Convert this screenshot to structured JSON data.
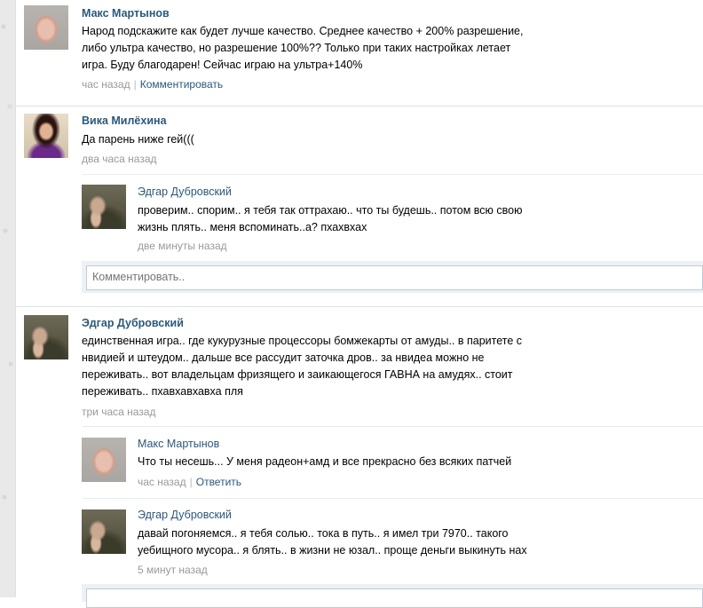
{
  "posts": [
    {
      "author": "Макс Мартынов",
      "lines": [
        "Народ подскажите как будет лучше качество. Среднее качество + 200% разрешение,",
        "либо ультра качество, но разрешение 100%?? Только при таких настройках летает",
        "игра. Буду благодарен! Сейчас играю на ультра+140%"
      ],
      "time": "час назад",
      "action": "Комментировать"
    },
    {
      "author": "Вика Милёхина",
      "lines": [
        "Да парень ниже гей((("
      ],
      "time": "два часа назад",
      "replies": [
        {
          "author": "Эдгар Дубровский",
          "lines": [
            "проверим.. спорим.. я тебя так оттрахаю.. что ты будешь.. потом всю свою",
            "жизнь плять.. меня вспоминать..а? пхахвхах"
          ],
          "time": "две минуты назад"
        }
      ],
      "comment_placeholder": "Комментировать.."
    },
    {
      "author": "Эдгар Дубровский",
      "lines": [
        "единственная игра.. где кукурузные процессоры бомжекарты от амуды.. в паритете с",
        "нвидией и штеудом.. дальше все рассудит заточка дров.. за нвидеа можно не",
        "переживать.. вот владельцам фризящего и заикающегося ГАВНА на амудях.. стоит",
        "переживать.. пхавхавхавха пля"
      ],
      "time": "три часа назад",
      "replies": [
        {
          "author": "Макс Мартынов",
          "lines": [
            "Что ты несешь... У меня радеон+амд и все прекрасно без всяких патчей"
          ],
          "time": "час назад",
          "action": "Ответить"
        },
        {
          "author": "Эдгар Дубровский",
          "lines": [
            "давай погоняемся.. я тебя солью.. тока в путь.. я имел три 7970.. такого",
            "уебищного мусора.. я блять.. в жизни не юзал.. проще деньги выкинуть нах"
          ],
          "time": "5 минут назад"
        }
      ]
    }
  ]
}
